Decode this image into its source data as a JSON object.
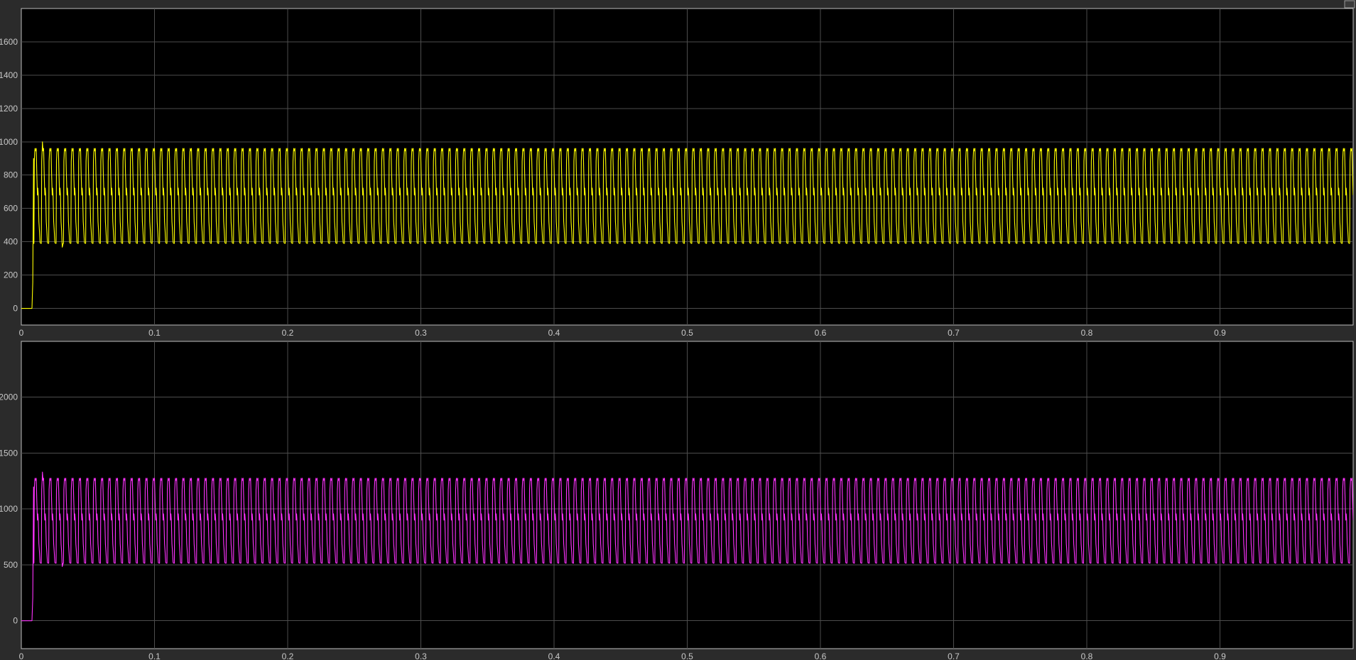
{
  "chart_data": [
    {
      "type": "line",
      "title": "",
      "xlabel": "",
      "ylabel": "",
      "xlim": [
        0,
        1
      ],
      "ylim": [
        -100,
        1800
      ],
      "x_ticks": [
        "0",
        "0.1",
        "0.2",
        "0.3",
        "0.4",
        "0.5",
        "0.6",
        "0.7",
        "0.8",
        "0.9"
      ],
      "y_ticks": [
        "0",
        "200",
        "400",
        "600",
        "800",
        "1000",
        "1200",
        "1400",
        "1600"
      ],
      "grid": true,
      "legend": "none",
      "background": "#000000",
      "series": [
        {
          "color": "#ffff00",
          "waveform": "periodic",
          "start_time": 0.008,
          "period": 0.00555,
          "steady_min": 390,
          "steady_max": 960,
          "steady_mid": 680,
          "initial_value": 0,
          "first_peak": 1000
        }
      ]
    },
    {
      "type": "line",
      "title": "",
      "xlabel": "",
      "ylabel": "",
      "xlim": [
        0,
        1
      ],
      "ylim": [
        -250,
        2500
      ],
      "x_ticks": [
        "0",
        "0.1",
        "0.2",
        "0.3",
        "0.4",
        "0.5",
        "0.6",
        "0.7",
        "0.8",
        "0.9"
      ],
      "y_ticks": [
        "0",
        "500",
        "1000",
        "1500",
        "2000"
      ],
      "grid": true,
      "legend": "none",
      "background": "#000000",
      "series": [
        {
          "color": "#ff33ff",
          "waveform": "periodic",
          "start_time": 0.008,
          "period": 0.00555,
          "steady_min": 515,
          "steady_max": 1275,
          "steady_mid": 900,
          "initial_value": 0,
          "first_peak": 1330
        }
      ]
    }
  ]
}
